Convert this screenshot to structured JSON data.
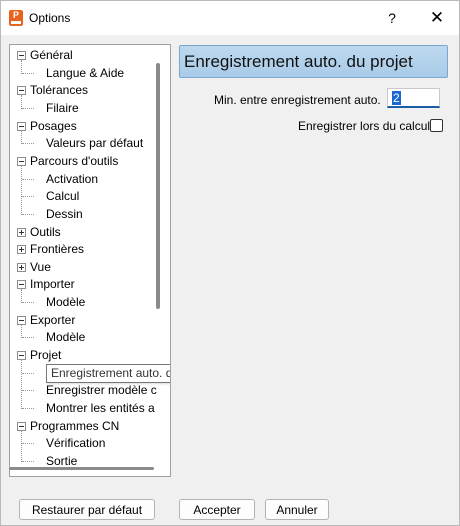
{
  "window": {
    "title": "Options",
    "help": "?",
    "close": "✕"
  },
  "tree": {
    "items": [
      {
        "label": "Général",
        "level": 0,
        "expander": "minus"
      },
      {
        "label": "Langue & Aide",
        "level": 1
      },
      {
        "label": "Tolérances",
        "level": 0,
        "expander": "minus"
      },
      {
        "label": "Filaire",
        "level": 1
      },
      {
        "label": "Posages",
        "level": 0,
        "expander": "minus"
      },
      {
        "label": "Valeurs par défaut",
        "level": 1
      },
      {
        "label": "Parcours d'outils",
        "level": 0,
        "expander": "minus"
      },
      {
        "label": "Activation",
        "level": 1
      },
      {
        "label": "Calcul",
        "level": 1
      },
      {
        "label": "Dessin",
        "level": 1
      },
      {
        "label": "Outils",
        "level": 0,
        "expander": "plus"
      },
      {
        "label": "Frontières",
        "level": 0,
        "expander": "plus"
      },
      {
        "label": "Vue",
        "level": 0,
        "expander": "plus"
      },
      {
        "label": "Importer",
        "level": 0,
        "expander": "minus"
      },
      {
        "label": "Modèle",
        "level": 1
      },
      {
        "label": "Exporter",
        "level": 0,
        "expander": "minus"
      },
      {
        "label": "Modèle",
        "level": 1
      },
      {
        "label": "Projet",
        "level": 0,
        "expander": "minus"
      },
      {
        "label": "Enregistrement auto. du projet",
        "level": 1,
        "selected": true
      },
      {
        "label": "Enregistrer modèle c",
        "level": 1
      },
      {
        "label": "Montrer les entités a",
        "level": 1
      },
      {
        "label": "Programmes CN",
        "level": 0,
        "expander": "minus"
      },
      {
        "label": "Vérification",
        "level": 1
      },
      {
        "label": "Sortie",
        "level": 1
      }
    ]
  },
  "panel": {
    "header": "Enregistrement auto. du projet",
    "interval_label": "Min. entre enregistrement auto.",
    "interval_value": "2",
    "save_on_calc_label": "Enregistrer lors du calcul",
    "save_on_calc_checked": false
  },
  "buttons": {
    "restore": "Restaurer par défaut",
    "accept": "Accepter",
    "cancel": "Annuler"
  }
}
